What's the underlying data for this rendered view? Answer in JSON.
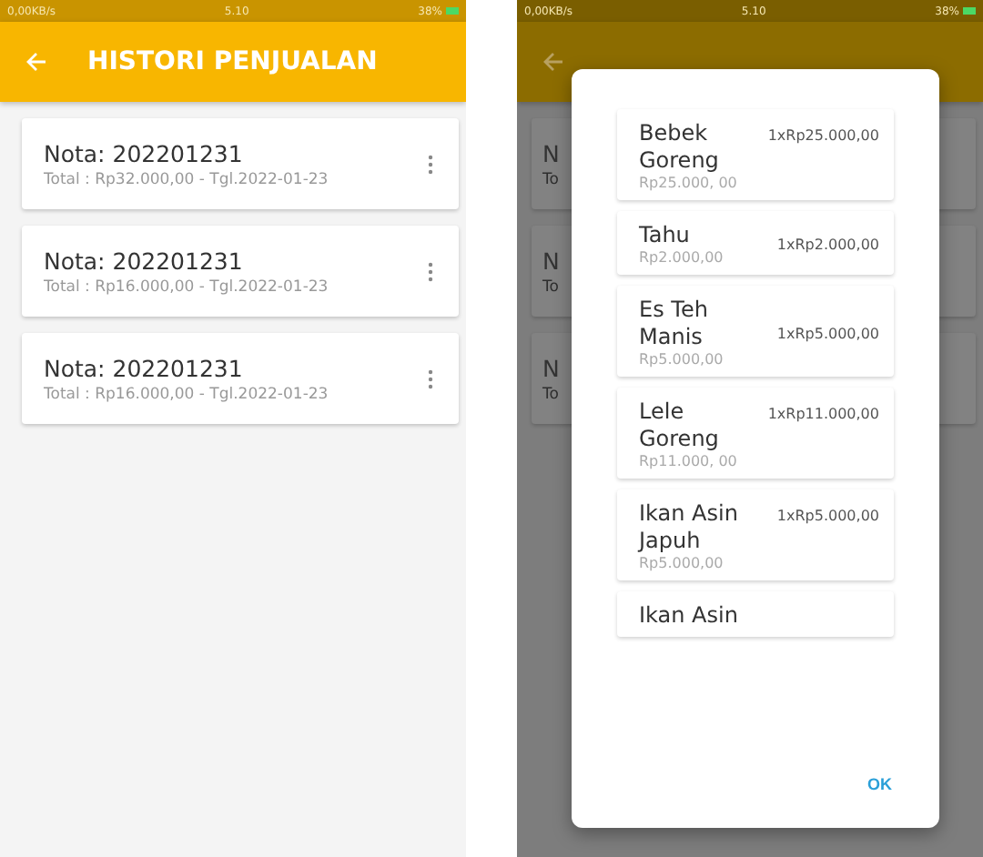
{
  "status_bar": {
    "network": "0,00KB/s",
    "time": "5.10",
    "battery": "38%"
  },
  "app_bar": {
    "title": "HISTORI PENJUALAN"
  },
  "sales": [
    {
      "nota": "Nota: 202201231",
      "detail": "Total : Rp32.000,00 - Tgl.2022-01-23"
    },
    {
      "nota": "Nota: 202201231",
      "detail": "Total : Rp16.000,00 - Tgl.2022-01-23"
    },
    {
      "nota": "Nota: 202201231",
      "detail": "Total : Rp16.000,00 - Tgl.2022-01-23"
    }
  ],
  "detail_screen": {
    "status_bar": {
      "network": "0,00KB/s",
      "time": "5.10",
      "battery": "38%"
    },
    "background_rows": [
      {
        "nota": "N",
        "detail": "To"
      },
      {
        "nota": "N",
        "detail": "To"
      },
      {
        "nota": "N",
        "detail": "To"
      }
    ],
    "dialog": {
      "items": [
        {
          "name": "Bebek Goreng",
          "price": "Rp25.000, 00",
          "total": "1xRp25.000,00"
        },
        {
          "name": "Tahu",
          "price": "Rp2.000,00",
          "total": "1xRp2.000,00"
        },
        {
          "name": "Es Teh Manis",
          "price": "Rp5.000,00",
          "total": "1xRp5.000,00"
        },
        {
          "name": "Lele Goreng",
          "price": "Rp11.000, 00",
          "total": "1xRp11.000,00"
        },
        {
          "name": "Ikan Asin Japuh",
          "price": "Rp5.000,00",
          "total": "1xRp5.000,00"
        },
        {
          "name": "Ikan Asin"
        }
      ],
      "ok_button": "OK"
    }
  }
}
